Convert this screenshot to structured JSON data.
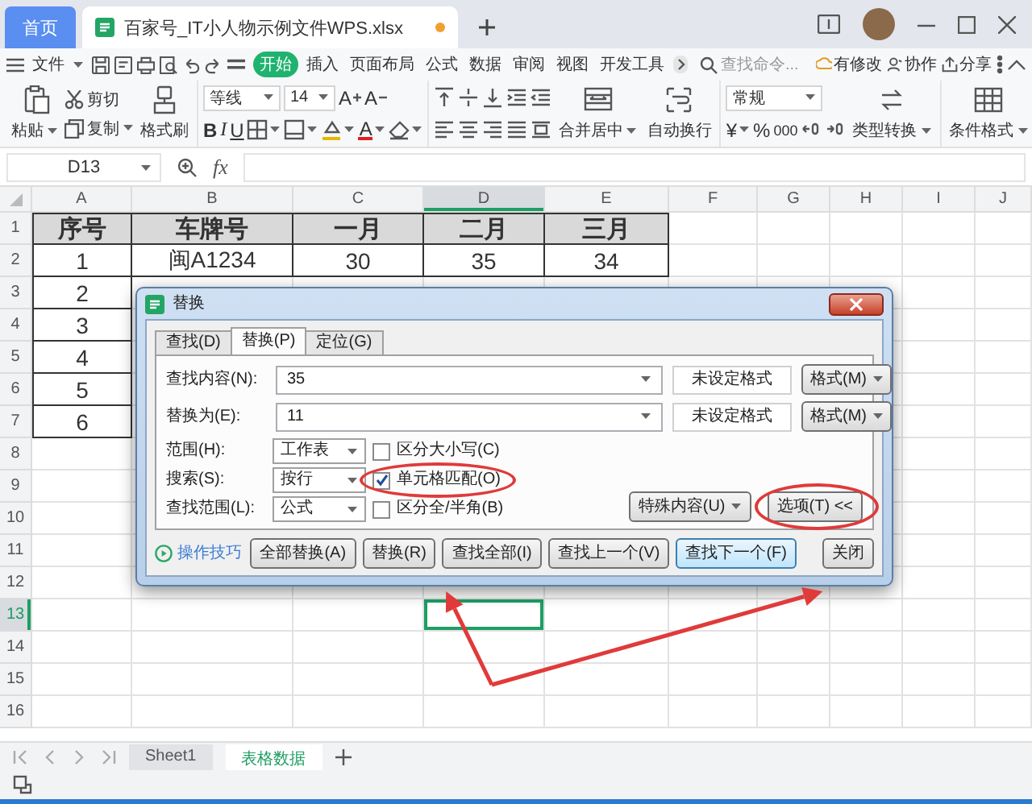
{
  "tabs": [
    {
      "kind": "home",
      "label": "首页",
      "selected": false
    },
    {
      "kind": "file",
      "label": "百家号_IT小人物示例文件WPS.xlsx",
      "selected": true,
      "modified": true
    }
  ],
  "menu": {
    "file": "文件",
    "tabs": [
      {
        "label": "开始",
        "selected": true
      },
      {
        "label": "插入",
        "selected": false
      },
      {
        "label": "页面布局",
        "selected": false
      },
      {
        "label": "公式",
        "selected": false
      },
      {
        "label": "数据",
        "selected": false
      },
      {
        "label": "审阅",
        "selected": false
      },
      {
        "label": "视图",
        "selected": false
      },
      {
        "label": "开发工具",
        "selected": false
      }
    ],
    "search": {
      "placeholder": "查找命令..."
    },
    "actions": [
      "有修改",
      "协作",
      "分享"
    ]
  },
  "ribbon": {
    "paste": "粘贴",
    "cut": "剪切",
    "copy": "复制",
    "format_painter": "格式刷",
    "font_name": "等线",
    "font_size": "14",
    "grow_font": "A",
    "shrink_font": "A",
    "bold": "B",
    "italic": "I",
    "underline": "U",
    "font_color": "A",
    "merge": "合并居中",
    "wrap": "自动换行",
    "number_format": "常规",
    "currency": "¥",
    "percent": "%",
    "thousands": "000",
    "convert": "类型转换",
    "conditional_format": "条件格式"
  },
  "formula_bar": {
    "cell": "D13",
    "function_label": "fx"
  },
  "sheet": {
    "columns": [
      {
        "label": "A",
        "selected": false
      },
      {
        "label": "B",
        "selected": false
      },
      {
        "label": "C",
        "selected": false
      },
      {
        "label": "D",
        "selected": true
      },
      {
        "label": "E",
        "selected": false
      },
      {
        "label": "F",
        "selected": false
      },
      {
        "label": "G",
        "selected": false
      },
      {
        "label": "H",
        "selected": false
      },
      {
        "label": "I",
        "selected": false
      },
      {
        "label": "J",
        "selected": false
      }
    ],
    "rows": [
      {
        "number": "1",
        "kind": "header",
        "selected": false,
        "cells": [
          "序号",
          "车牌号",
          "一月",
          "二月",
          "三月"
        ]
      },
      {
        "number": "2",
        "kind": "data",
        "selected": false,
        "cells": [
          "1",
          "闽A1234",
          "30",
          "35",
          "34"
        ]
      },
      {
        "number": "3",
        "kind": "data",
        "selected": false,
        "cells": [
          "2"
        ]
      },
      {
        "number": "4",
        "kind": "data",
        "selected": false,
        "cells": [
          "3"
        ]
      },
      {
        "number": "5",
        "kind": "data",
        "selected": false,
        "cells": [
          "4"
        ]
      },
      {
        "number": "6",
        "kind": "data",
        "selected": false,
        "cells": [
          "5"
        ]
      },
      {
        "number": "7",
        "kind": "data",
        "selected": false,
        "cells": [
          "6"
        ]
      },
      {
        "number": "8",
        "kind": "data",
        "selected": false
      },
      {
        "number": "9",
        "kind": "data",
        "selected": false
      },
      {
        "number": "10",
        "kind": "data",
        "selected": false
      },
      {
        "number": "11",
        "kind": "data",
        "selected": false
      },
      {
        "number": "12",
        "kind": "data",
        "selected": false
      },
      {
        "number": "13",
        "kind": "data",
        "selected": true
      },
      {
        "number": "14",
        "kind": "data",
        "selected": false
      },
      {
        "number": "15",
        "kind": "data",
        "selected": false
      },
      {
        "number": "16",
        "kind": "data",
        "selected": false
      }
    ]
  },
  "sheet_tabs": [
    {
      "label": "Sheet1",
      "selected": false
    },
    {
      "label": "表格数据",
      "selected": true
    }
  ],
  "dialog": {
    "title": "替换",
    "tabs": [
      {
        "label": "查找(D)",
        "selected": false
      },
      {
        "label": "替换(P)",
        "selected": true
      },
      {
        "label": "定位(G)",
        "selected": false
      }
    ],
    "fields": [
      {
        "label": "查找内容(N):",
        "value": "35",
        "format_status": "未设定格式",
        "format_button": "格式(M)"
      },
      {
        "label": "替换为(E):",
        "value": "11",
        "format_status": "未设定格式",
        "format_button": "格式(M)"
      }
    ],
    "options": [
      {
        "label": "范围(H):",
        "select": "工作表",
        "checkbox": {
          "label": "区分大小写(C)",
          "checked": false,
          "highlighted": false
        }
      },
      {
        "label": "搜索(S):",
        "select": "按行",
        "checkbox": {
          "label": "单元格匹配(O)",
          "checked": true,
          "highlighted": true
        }
      },
      {
        "label": "查找范围(L):",
        "select": "公式",
        "checkbox": {
          "label": "区分全/半角(B)",
          "checked": false,
          "highlighted": false
        }
      }
    ],
    "special_button": "特殊内容(U)",
    "options_button": {
      "label": "选项(T) <<",
      "highlighted": true
    },
    "tips_link": "操作技巧",
    "buttons": [
      {
        "label": "全部替换(A)",
        "default": false
      },
      {
        "label": "替换(R)",
        "default": false
      },
      {
        "label": "查找全部(I)",
        "default": false
      },
      {
        "label": "查找上一个(V)",
        "default": false
      },
      {
        "label": "查找下一个(F)",
        "default": true
      },
      {
        "label": "关闭",
        "default": false
      }
    ]
  }
}
